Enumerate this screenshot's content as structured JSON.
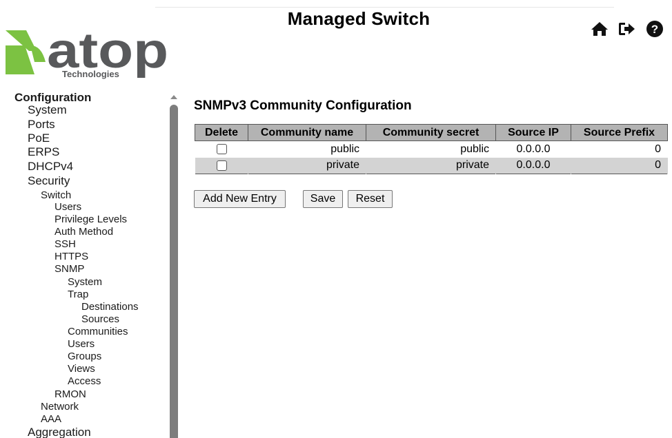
{
  "header": {
    "title": "Managed Switch",
    "logo": {
      "brand": "atop",
      "tagline": "Technologies"
    },
    "icons": [
      "home-icon",
      "logout-icon",
      "help-icon"
    ]
  },
  "sidebar": {
    "items": [
      {
        "label": "Configuration",
        "level": 0
      },
      {
        "label": "System",
        "level": 1
      },
      {
        "label": "Ports",
        "level": 1
      },
      {
        "label": "PoE",
        "level": 1
      },
      {
        "label": "ERPS",
        "level": 1
      },
      {
        "label": "DHCPv4",
        "level": 1
      },
      {
        "label": "Security",
        "level": 1
      },
      {
        "label": "Switch",
        "level": 2
      },
      {
        "label": "Users",
        "level": 3
      },
      {
        "label": "Privilege Levels",
        "level": 3
      },
      {
        "label": "Auth Method",
        "level": 3
      },
      {
        "label": "SSH",
        "level": 3
      },
      {
        "label": "HTTPS",
        "level": 3
      },
      {
        "label": "SNMP",
        "level": 3
      },
      {
        "label": "System",
        "level": 4
      },
      {
        "label": "Trap",
        "level": 4
      },
      {
        "label": "Destinations",
        "level": 5
      },
      {
        "label": "Sources",
        "level": 5
      },
      {
        "label": "Communities",
        "level": 4
      },
      {
        "label": "Users",
        "level": 4
      },
      {
        "label": "Groups",
        "level": 4
      },
      {
        "label": "Views",
        "level": 4
      },
      {
        "label": "Access",
        "level": 4
      },
      {
        "label": "RMON",
        "level": 3
      },
      {
        "label": "Network",
        "level": 2
      },
      {
        "label": "AAA",
        "level": 2
      },
      {
        "label": "Aggregation",
        "level": 1
      }
    ]
  },
  "main": {
    "page_title": "SNMPv3 Community Configuration",
    "table": {
      "headers": [
        "Delete",
        "Community name",
        "Community secret",
        "Source IP",
        "Source Prefix"
      ],
      "rows": [
        {
          "delete": false,
          "name": "public",
          "secret": "public",
          "source_ip": "0.0.0.0",
          "source_prefix": "0"
        },
        {
          "delete": false,
          "name": "private",
          "secret": "private",
          "source_ip": "0.0.0.0",
          "source_prefix": "0"
        }
      ]
    },
    "buttons": {
      "add": "Add New Entry",
      "save": "Save",
      "reset": "Reset"
    }
  },
  "colors": {
    "logo_green": "#7cc242",
    "logo_gray": "#58595b",
    "table_header_bg": "#b3b3b3",
    "row_alt_bg": "#d3d3d3"
  }
}
